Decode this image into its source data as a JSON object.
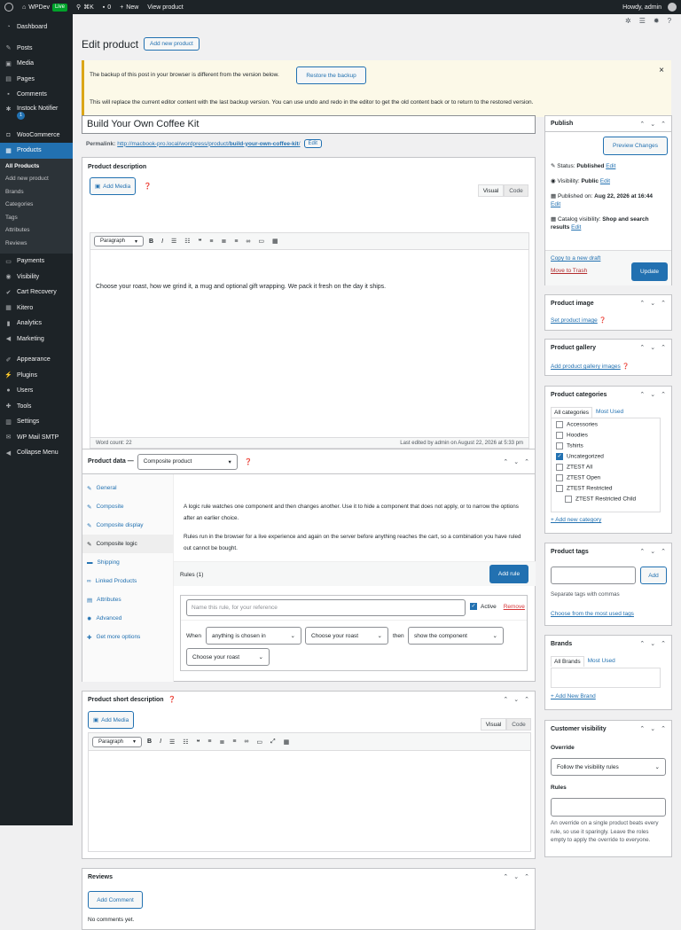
{
  "adminbar": {
    "site": "WPDev",
    "live": "Live",
    "shortcut": "⌘K",
    "comments": "0",
    "new": "New",
    "view": "View product",
    "howdy": "Howdy, admin"
  },
  "menu": {
    "dashboard": "Dashboard",
    "posts": "Posts",
    "media": "Media",
    "pages": "Pages",
    "comments": "Comments",
    "instock": "Instock Notifier",
    "instock_badge": "1",
    "woocommerce": "WooCommerce",
    "products": "Products",
    "sub": [
      "All Products",
      "Add new product",
      "Brands",
      "Categories",
      "Tags",
      "Attributes",
      "Reviews"
    ],
    "payments": "Payments",
    "visibility": "Visibility",
    "cart_recovery": "Cart Recovery",
    "kitero": "Kitero",
    "analytics": "Analytics",
    "marketing": "Marketing",
    "appearance": "Appearance",
    "plugins": "Plugins",
    "users": "Users",
    "tools": "Tools",
    "settings": "Settings",
    "wp_mail": "WP Mail SMTP",
    "collapse": "Collapse Menu"
  },
  "page": {
    "title": "Edit product",
    "add_new": "Add new product"
  },
  "notice": {
    "line1": "The backup of this post in your browser is different from the version below.",
    "restore": "Restore the backup",
    "line2": "This will replace the current editor content with the last backup version. You can use undo and redo in the editor to get the old content back or to return to the restored version.",
    "close": "×"
  },
  "post": {
    "title": "Build Your Own Coffee Kit",
    "permalink_label": "Permalink:",
    "permalink_base": "http://macbook-pro.local/wordpress/product/",
    "permalink_slug": "build-your-own-coffee-kit",
    "permalink_end": "/",
    "edit": "Edit"
  },
  "desc": {
    "heading": "Product description",
    "add_media": "Add Media",
    "visual": "Visual",
    "code": "Code",
    "format": "Paragraph",
    "content": "Choose your roast, how we grind it, a mug and optional gift wrapping. We pack it fresh on the day it ships.",
    "word_count": "Word count: 22",
    "last_edited": "Last edited by admin on August 22, 2026 at 5:33 pm"
  },
  "pdata": {
    "heading": "Product data —",
    "type": "Composite product",
    "tabs": [
      "General",
      "Composite",
      "Composite display",
      "Composite logic",
      "Shipping",
      "Linked Products",
      "Attributes",
      "Advanced",
      "Get more options"
    ],
    "p1": "A logic rule watches one component and then changes another. Use it to hide a component that does not apply, or to narrow the options after an earlier choice.",
    "p2": "Rules run in the browser for a live experience and again on the server before anything reaches the cart, so a combination you have ruled out cannot be bought.",
    "rules_label": "Rules (1)",
    "add_rule": "Add rule",
    "rule_name_ph": "Name this rule, for your reference",
    "active": "Active",
    "remove": "Remove",
    "when": "When",
    "cond": "anything is chosen in",
    "roast1": "Choose your roast",
    "then": "then",
    "action": "show the component",
    "roast2": "Choose your roast"
  },
  "short": {
    "heading": "Product short description",
    "add_media": "Add Media",
    "visual": "Visual",
    "code": "Code",
    "format": "Paragraph"
  },
  "reviews": {
    "heading": "Reviews",
    "add": "Add Comment",
    "none": "No comments yet."
  },
  "publish": {
    "heading": "Publish",
    "preview": "Preview Changes",
    "status_l": "Status:",
    "status_v": "Published",
    "vis_l": "Visibility:",
    "vis_v": "Public",
    "pub_l": "Published on:",
    "pub_v": "Aug 22, 2026 at 16:44",
    "cat_l": "Catalog visibility:",
    "cat_v": "Shop and search results",
    "edit": "Edit",
    "copy": "Copy to a new draft",
    "trash": "Move to Trash",
    "update": "Update"
  },
  "pimage": {
    "heading": "Product image",
    "link": "Set product image"
  },
  "gallery": {
    "heading": "Product gallery",
    "link": "Add product gallery images"
  },
  "cats": {
    "heading": "Product categories",
    "tab_all": "All categories",
    "tab_used": "Most Used",
    "items": [
      "Accessories",
      "Hoodies",
      "Tshirts",
      "Uncategorized",
      "ZTEST All",
      "ZTEST Open",
      "ZTEST Restricted",
      "ZTEST Restricted Child"
    ],
    "add": "+ Add new category"
  },
  "tags": {
    "heading": "Product tags",
    "add": "Add",
    "hint": "Separate tags with commas",
    "choose": "Choose from the most used tags"
  },
  "brands": {
    "heading": "Brands",
    "tab_all": "All Brands",
    "tab_used": "Most Used",
    "add": "+ Add New Brand"
  },
  "cvis": {
    "heading": "Customer visibility",
    "override": "Override",
    "follow": "Follow the visibility rules",
    "rules": "Rules",
    "help": "An override on a single product beats every rule, so use it sparingly. Leave the roles empty to apply the override to everyone."
  },
  "glyphs": {
    "up": "⌃",
    "down": "⌄",
    "tri": "▾"
  }
}
